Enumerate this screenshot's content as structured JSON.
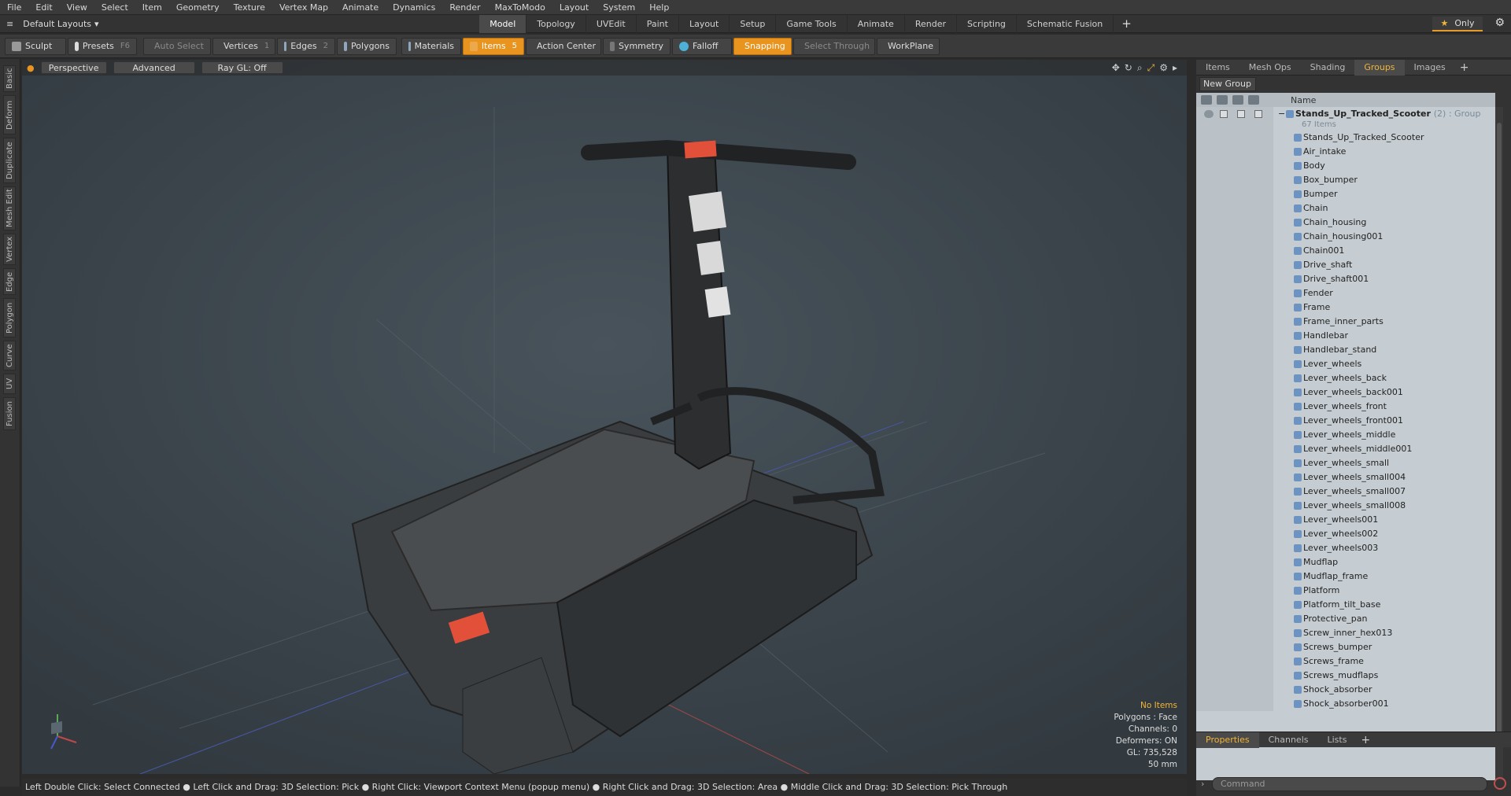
{
  "menubar": [
    "File",
    "Edit",
    "View",
    "Select",
    "Item",
    "Geometry",
    "Texture",
    "Vertex Map",
    "Animate",
    "Dynamics",
    "Render",
    "MaxToModo",
    "Layout",
    "System",
    "Help"
  ],
  "layoutbar": {
    "layout_select": "Default Layouts",
    "tabs": [
      "Model",
      "Topology",
      "UVEdit",
      "Paint",
      "Layout",
      "Setup",
      "Game Tools",
      "Animate",
      "Render",
      "Scripting",
      "Schematic Fusion"
    ],
    "active_tab": "Model",
    "only_label": "Only"
  },
  "toolbar": {
    "sculpt": "Sculpt",
    "presets": "Presets",
    "presets_key": "F6",
    "auto_select": "Auto Select",
    "vertices": "Vertices",
    "vertices_key": "1",
    "edges": "Edges",
    "edges_key": "2",
    "polygons": "Polygons",
    "materials": "Materials",
    "items": "Items",
    "items_key": "5",
    "action_center": "Action Center",
    "symmetry": "Symmetry",
    "falloff": "Falloff",
    "snapping": "Snapping",
    "select_through": "Select Through",
    "workplane": "WorkPlane"
  },
  "leftstrip": [
    "Basic",
    "Deform",
    "Duplicate",
    "Mesh Edit",
    "Vertex",
    "Edge",
    "Polygon",
    "Curve",
    "UV",
    "Fusion"
  ],
  "viewport": {
    "perspective": "Perspective",
    "advanced": "Advanced",
    "raygl": "Ray GL: Off",
    "stats": {
      "no_items": "No Items",
      "polygons": "Polygons : Face",
      "channels": "Channels: 0",
      "deformers": "Deformers: ON",
      "gl": "GL: 735,528",
      "unit": "50 mm"
    }
  },
  "statusbar": "Left Double Click: Select Connected ● Left Click and Drag: 3D Selection: Pick ● Right Click: Viewport Context Menu (popup menu) ● Right Click and Drag: 3D Selection: Area ● Middle Click and Drag: 3D Selection: Pick Through",
  "rightpanel": {
    "tabs": [
      "Items",
      "Mesh Ops",
      "Shading",
      "Groups",
      "Images"
    ],
    "active_tab": "Groups",
    "new_group": "New Group",
    "name_header": "Name",
    "group": {
      "name": "Stands_Up_Tracked_Scooter",
      "type": "(2) : Group",
      "count": "67 Items"
    },
    "items": [
      "Stands_Up_Tracked_Scooter",
      "Air_intake",
      "Body",
      "Box_bumper",
      "Bumper",
      "Chain",
      "Chain_housing",
      "Chain_housing001",
      "Chain001",
      "Drive_shaft",
      "Drive_shaft001",
      "Fender",
      "Frame",
      "Frame_inner_parts",
      "Handlebar",
      "Handlebar_stand",
      "Lever_wheels",
      "Lever_wheels_back",
      "Lever_wheels_back001",
      "Lever_wheels_front",
      "Lever_wheels_front001",
      "Lever_wheels_middle",
      "Lever_wheels_middle001",
      "Lever_wheels_small",
      "Lever_wheels_small004",
      "Lever_wheels_small007",
      "Lever_wheels_small008",
      "Lever_wheels001",
      "Lever_wheels002",
      "Lever_wheels003",
      "Mudflap",
      "Mudflap_frame",
      "Platform",
      "Platform_tilt_base",
      "Protective_pan",
      "Screw_inner_hex013",
      "Screws_bumper",
      "Screws_frame",
      "Screws_mudflaps",
      "Shock_absorber",
      "Shock_absorber001"
    ],
    "bottom_tabs": [
      "Properties",
      "Channels",
      "Lists"
    ],
    "command_placeholder": "Command"
  },
  "colors": {
    "accent": "#e8941f",
    "list_bg": "#c6cdd2",
    "viewport_bg": "#3d474f"
  }
}
